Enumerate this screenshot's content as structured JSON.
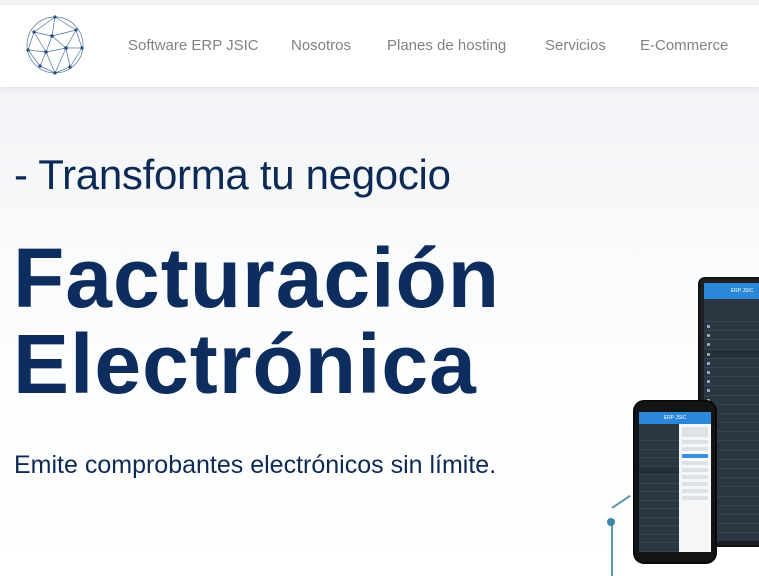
{
  "nav": {
    "items": [
      {
        "label": "Software ERP JSIC"
      },
      {
        "label": "Nosotros"
      },
      {
        "label": "Planes de hosting"
      },
      {
        "label": "Servicios"
      },
      {
        "label": "E-Commerce"
      }
    ]
  },
  "hero": {
    "subtitle": "- Transforma tu negocio",
    "title_line1": "Facturación",
    "title_line2": "Electrónica",
    "description": "Emite comprobantes electrónicos sin límite."
  },
  "mockup": {
    "app_title": "ERP JSIC"
  },
  "colors": {
    "heading_navy": "#0c2d5e",
    "nav_text": "#7f8186",
    "app_blue": "#2b88d8",
    "app_sidebar": "#2a3642"
  },
  "icons": {
    "logo": "network-globe-icon"
  }
}
